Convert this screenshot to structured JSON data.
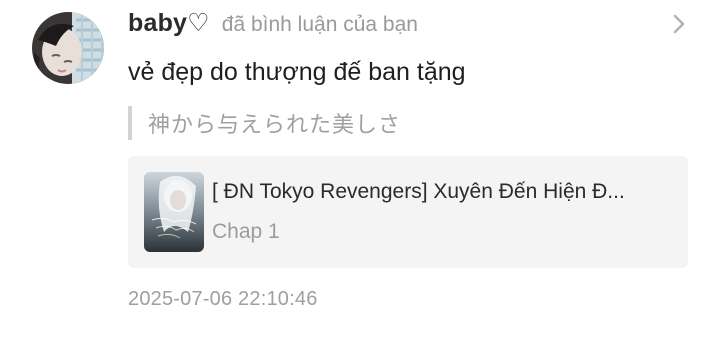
{
  "notification": {
    "avatar_icon": "user-avatar",
    "username": "baby♡",
    "action_text": "đã bình luận của bạn",
    "chevron_icon": "chevron-right-icon",
    "comment_text": "vẻ đẹp do thượng đế ban tặng",
    "quoted_text": "神から与えられた美しさ",
    "story": {
      "cover_icon": "story-cover-image",
      "title": "[ ĐN Tokyo Revengers] Xuyên Đến Hiện Đ...",
      "chapter": "Chap 1"
    },
    "timestamp": "2025-07-06 22:10:46"
  },
  "colors": {
    "username": "#2b2b2b",
    "muted_text": "#9a9a9a",
    "quote_bar": "#d3d3d3",
    "story_background": "#f4f4f4",
    "chevron": "#b3b3b3"
  }
}
